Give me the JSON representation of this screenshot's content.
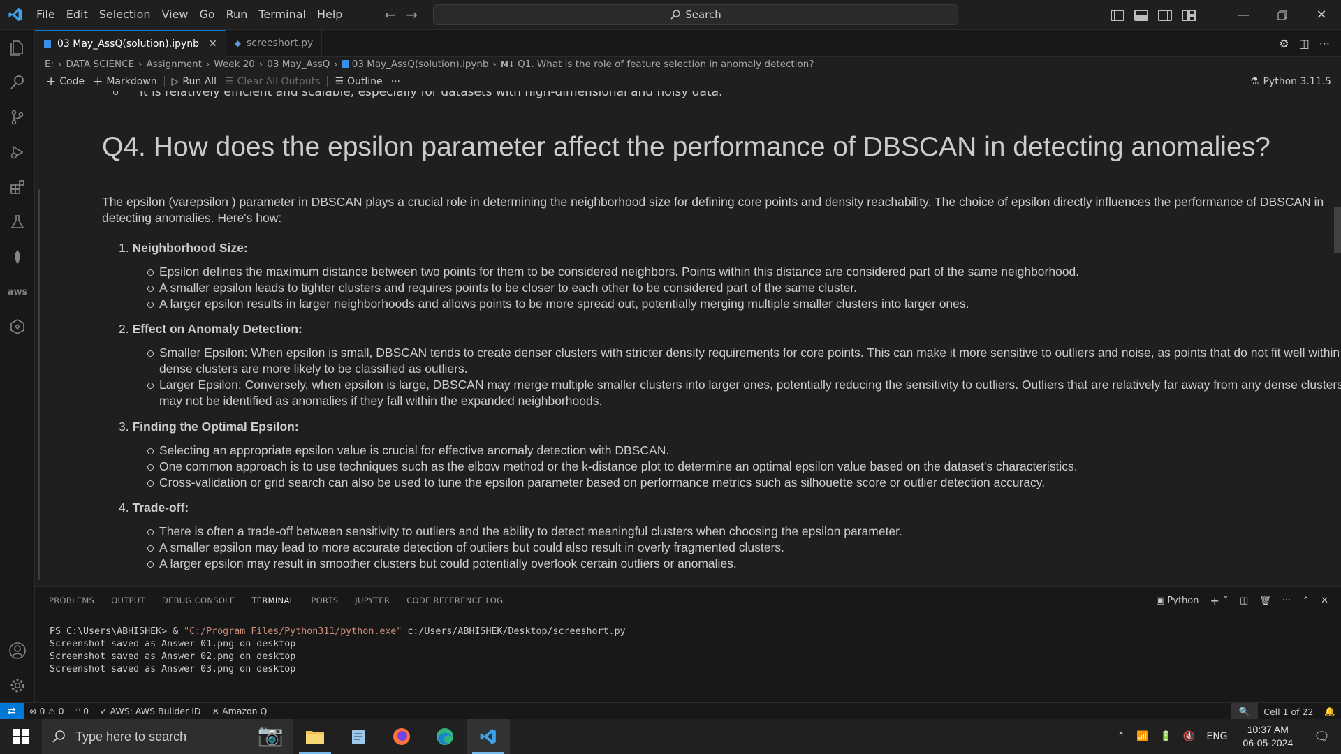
{
  "menu": [
    "File",
    "Edit",
    "Selection",
    "View",
    "Go",
    "Run",
    "Terminal",
    "Help"
  ],
  "search": {
    "label": "Search"
  },
  "tabs": [
    {
      "label": "03 May_AssQ(solution).ipynb",
      "active": true
    },
    {
      "label": "screeshort.py",
      "active": false
    }
  ],
  "breadcrumb": [
    "E:",
    "DATA SCIENCE",
    "Assignment",
    "Week 20",
    "03 May_AssQ",
    "03 May_AssQ(solution).ipynb",
    "Q1. What is the role of feature selection in anomaly detection?"
  ],
  "breadcrumb_md_tag": "M↓",
  "toolbar": {
    "code": "Code",
    "markdown": "Markdown",
    "run_all": "Run All",
    "clear_outputs": "Clear All Outputs",
    "outline": "Outline",
    "more": "···",
    "kernel": "Python 3.11.5"
  },
  "notebook": {
    "cut_line": "It is relatively efficient and scalable, especially for datasets with high-dimensional and noisy data.",
    "heading": "Q4. How does the epsilon parameter affect the performance of DBSCAN in detecting anomalies?",
    "intro": "The epsilon (varepsilon ) parameter in DBSCAN plays a crucial role in determining the neighborhood size for defining core points and density reachability. The choice of epsilon directly influences the performance of DBSCAN in detecting anomalies. Here's how:",
    "sections": [
      {
        "num": "1.",
        "title": "Neighborhood Size:",
        "bullets": [
          "Epsilon defines the maximum distance between two points for them to be considered neighbors. Points within this distance are considered part of the same neighborhood.",
          "A smaller epsilon leads to tighter clusters and requires points to be closer to each other to be considered part of the same cluster.",
          "A larger epsilon results in larger neighborhoods and allows points to be more spread out, potentially merging multiple smaller clusters into larger ones."
        ]
      },
      {
        "num": "2.",
        "title": "Effect on Anomaly Detection:",
        "bullets": [
          "Smaller Epsilon: When epsilon is small, DBSCAN tends to create denser clusters with stricter density requirements for core points. This can make it more sensitive to outliers and noise, as points that do not fit well within dense clusters are more likely to be classified as outliers.",
          "Larger Epsilon: Conversely, when epsilon is large, DBSCAN may merge multiple smaller clusters into larger ones, potentially reducing the sensitivity to outliers. Outliers that are relatively far away from any dense clusters may not be identified as anomalies if they fall within the expanded neighborhoods."
        ]
      },
      {
        "num": "3.",
        "title": "Finding the Optimal Epsilon:",
        "bullets": [
          "Selecting an appropriate epsilon value is crucial for effective anomaly detection with DBSCAN.",
          "One common approach is to use techniques such as the elbow method or the k-distance plot to determine an optimal epsilon value based on the dataset's characteristics.",
          "Cross-validation or grid search can also be used to tune the epsilon parameter based on performance metrics such as silhouette score or outlier detection accuracy."
        ]
      },
      {
        "num": "4.",
        "title": "Trade-off:",
        "bullets": [
          "There is often a trade-off between sensitivity to outliers and the ability to detect meaningful clusters when choosing the epsilon parameter.",
          "A smaller epsilon may lead to more accurate detection of outliers but could also result in overly fragmented clusters.",
          "A larger epsilon may result in smoother clusters but could potentially overlook certain outliers or anomalies."
        ]
      }
    ]
  },
  "panel": {
    "tabs": [
      "PROBLEMS",
      "OUTPUT",
      "DEBUG CONSOLE",
      "TERMINAL",
      "PORTS",
      "JUPYTER",
      "CODE REFERENCE LOG"
    ],
    "active_tab": "TERMINAL",
    "terminal_profile": "Python",
    "terminal": {
      "prompt": "PS C:\\Users\\ABHISHEK> & ",
      "exe": "\"C:/Program Files/Python311/python.exe\"",
      "script": " c:/Users/ABHISHEK/Desktop/screeshort.py",
      "lines": [
        "Screenshot saved as Answer 01.png on desktop",
        "Screenshot saved as Answer 02.png on desktop",
        "Screenshot saved as Answer 03.png on desktop"
      ]
    }
  },
  "statusbar": {
    "errors": "0",
    "warnings": "0",
    "ports": "0",
    "aws": "AWS: AWS Builder ID",
    "amazon_q": "Amazon Q",
    "cell": "Cell 1 of 22"
  },
  "taskbar": {
    "search_placeholder": "Type here to search",
    "lang": "ENG",
    "time": "10:37 AM",
    "date": "06-05-2024"
  },
  "colors": {
    "accent": "#0078d4",
    "background": "#1f1f1f",
    "terminal_string": "#ce9178"
  }
}
